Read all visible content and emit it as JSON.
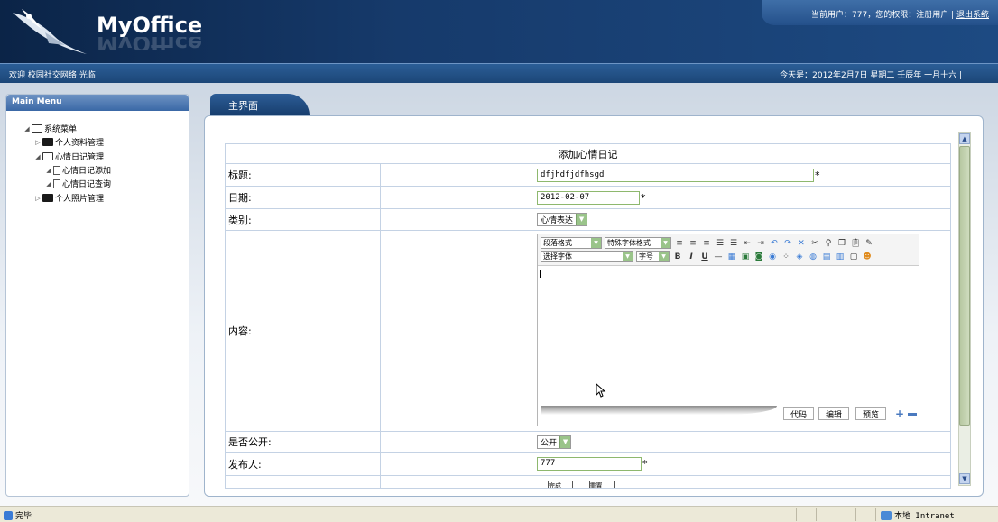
{
  "header": {
    "logo_text": "MyOffice",
    "user_info": "当前用户：777，您的权限：注册用户 |",
    "logout_link": "退出系统"
  },
  "infobar": {
    "welcome": "欢迎 校园社交网络 光临",
    "date": "今天是：2012年2月7日 星期二 壬辰年 一月十六 |"
  },
  "left_menu": {
    "title": "Main Menu",
    "root": "系统菜单",
    "items": [
      {
        "label": "个人资料管理"
      },
      {
        "label": "心情日记管理"
      },
      {
        "label": "心情日记添加"
      },
      {
        "label": "心情日记查询"
      },
      {
        "label": "个人照片管理"
      }
    ]
  },
  "tab": {
    "label": "主界面"
  },
  "form": {
    "title": "添加心情日记",
    "title_label": "标题:",
    "title_value": "dfjhdfjdfhsgd",
    "date_label": "日期:",
    "date_value": "2012-02-07",
    "category_label": "类别:",
    "category_value": "心情表达",
    "content_label": "内容:",
    "public_label": "是否公开:",
    "public_value": "公开",
    "publisher_label": "发布人:",
    "publisher_value": "777",
    "required_mark": "*",
    "submit_label": "完成",
    "reset_label": "重置"
  },
  "editor": {
    "paragraph_format": "段落格式",
    "special_format": "特殊字体格式",
    "font_select": "选择字体",
    "font_size": "字号",
    "mode_code": "代码",
    "mode_edit": "编辑",
    "mode_preview": "预览"
  },
  "statusbar": {
    "left_text": "完毕",
    "zone_text": "本地 Intranet"
  }
}
